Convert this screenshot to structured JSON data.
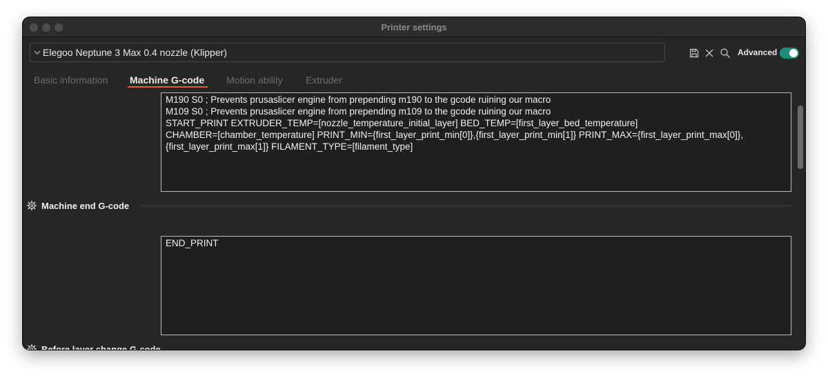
{
  "window": {
    "title": "Printer settings"
  },
  "preset": {
    "name": "Elegoo Neptune 3 Max 0.4 nozzle (Klipper)"
  },
  "toolbar": {
    "save_icon": "save-icon",
    "close_icon": "close-icon",
    "search_icon": "search-icon",
    "advanced_label": "Advanced",
    "advanced_on": true,
    "toggle_color": "#1f8f7c"
  },
  "tabs": [
    {
      "label": "Basic information",
      "active": false
    },
    {
      "label": "Machine G-code",
      "active": true
    },
    {
      "label": "Motion ability",
      "active": false
    },
    {
      "label": "Extruder",
      "active": false
    }
  ],
  "accent_color": "#e35d3a",
  "main": {
    "start_gcode": "M190 S0 ; Prevents prusaslicer engine from prepending m190 to the gcode ruining our macro\nM109 S0 ; Prevents prusaslicer engine from prepending m109 to the gcode ruining our macro\nSTART_PRINT EXTRUDER_TEMP=[nozzle_temperature_initial_layer] BED_TEMP=[first_layer_bed_temperature]\nCHAMBER=[chamber_temperature] PRINT_MIN={first_layer_print_min[0]},{first_layer_print_min[1]} PRINT_MAX={first_layer_print_max[0]},\n{first_layer_print_max[1]} FILAMENT_TYPE=[filament_type]",
    "end_section_label": "Machine end G-code",
    "end_gcode": "END_PRINT",
    "next_section_label": "Before layer change G-code"
  }
}
